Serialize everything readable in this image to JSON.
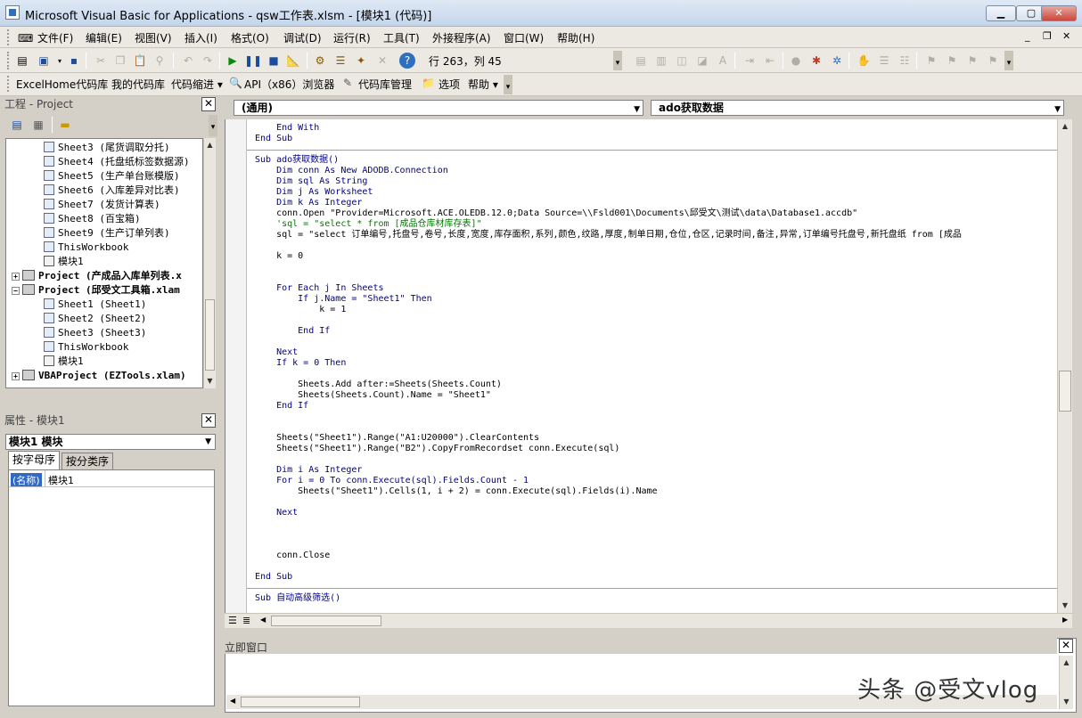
{
  "window": {
    "title": "Microsoft Visual Basic for Applications - qsw工作表.xlsm - [模块1 (代码)]",
    "min": "▁",
    "max": "▢",
    "close": "✕"
  },
  "menu": {
    "items": [
      "文件(F)",
      "编辑(E)",
      "视图(V)",
      "插入(I)",
      "格式(O)",
      "调试(D)",
      "运行(R)",
      "工具(T)",
      "外接程序(A)",
      "窗口(W)",
      "帮助(H)"
    ],
    "mdi_min": "_",
    "mdi_restore": "❐",
    "mdi_close": "✕"
  },
  "toolbar": {
    "position": "行 263，列 45"
  },
  "toolbar2": {
    "items": [
      "ExcelHome代码库",
      "我的代码库",
      "代码缩进 ▾",
      "API（x86）浏览器",
      "代码库管理",
      "选项",
      "帮助 ▾"
    ]
  },
  "project_panel": {
    "title": "工程 - Project",
    "close": "✕"
  },
  "tree": [
    {
      "label": "Sheet3 (尾货调取分托)",
      "type": "sheet"
    },
    {
      "label": "Sheet4 (托盘纸标签数据源)",
      "type": "sheet"
    },
    {
      "label": "Sheet5 (生产单台账模版)",
      "type": "sheet"
    },
    {
      "label": "Sheet6 (入库差异对比表)",
      "type": "sheet"
    },
    {
      "label": "Sheet7 (发货计算表)",
      "type": "sheet"
    },
    {
      "label": "Sheet8 (百宝箱)",
      "type": "sheet"
    },
    {
      "label": "Sheet9 (生产订单列表)",
      "type": "sheet"
    },
    {
      "label": "ThisWorkbook",
      "type": "sheet"
    },
    {
      "label": "模块1",
      "type": "module"
    },
    {
      "label": "Project (产成品入库单列表.x",
      "type": "project",
      "toggle": "+"
    },
    {
      "label": "Project (邱受文工具箱.xlam",
      "type": "project",
      "toggle": "−"
    },
    {
      "label": "Sheet1 (Sheet1)",
      "type": "sheet"
    },
    {
      "label": "Sheet2 (Sheet2)",
      "type": "sheet"
    },
    {
      "label": "Sheet3 (Sheet3)",
      "type": "sheet"
    },
    {
      "label": "ThisWorkbook",
      "type": "sheet"
    },
    {
      "label": "模块1",
      "type": "module"
    },
    {
      "label": "VBAProject (EZTools.xlam)",
      "type": "project",
      "toggle": "+"
    }
  ],
  "props_panel": {
    "title": "属性 - 模块1",
    "close": "✕",
    "object": "模块1 模块",
    "tab_alpha": "按字母序",
    "tab_cat": "按分类序",
    "prop_key": "(名称)",
    "prop_val": "模块1"
  },
  "code_panel": {
    "object_combo": "(通用)",
    "proc_combo": "ado获取数据"
  },
  "code_lines": [
    {
      "text": "    End With",
      "kind": "kw"
    },
    {
      "text": "End Sub",
      "kind": "kw"
    },
    {
      "text": "",
      "kind": "sep"
    },
    {
      "text": "Sub ado获取数据()",
      "kind": "kw"
    },
    {
      "text": "    Dim conn As New ADODB.Connection",
      "kind": "kw"
    },
    {
      "text": "    Dim sql As String",
      "kind": "kw"
    },
    {
      "text": "    Dim j As Worksheet",
      "kind": "kw"
    },
    {
      "text": "    Dim k As Integer",
      "kind": "kw"
    },
    {
      "text": "    conn.Open \"Provider=Microsoft.ACE.OLEDB.12.0;Data Source=\\\\Fsld001\\Documents\\邱受文\\测试\\data\\Database1.accdb\"",
      "kind": "code"
    },
    {
      "text": "    'sql = \"select * from [成品仓库材库存表]\"",
      "kind": "cm"
    },
    {
      "text": "    sql = \"select 订单编号,托盘号,卷号,长度,宽度,库存面积,系列,颜色,纹路,厚度,制单日期,仓位,仓区,记录时间,备注,异常,订单编号托盘号,新托盘纸 from [成品",
      "kind": "code"
    },
    {
      "text": "",
      "kind": "code"
    },
    {
      "text": "    k = 0",
      "kind": "code"
    },
    {
      "text": "",
      "kind": "code"
    },
    {
      "text": "",
      "kind": "code"
    },
    {
      "text": "    For Each j In Sheets",
      "kind": "kw"
    },
    {
      "text": "        If j.Name = \"Sheet1\" Then",
      "kind": "kw"
    },
    {
      "text": "            k = 1",
      "kind": "code"
    },
    {
      "text": "",
      "kind": "code"
    },
    {
      "text": "        End If",
      "kind": "kw"
    },
    {
      "text": "",
      "kind": "code"
    },
    {
      "text": "    Next",
      "kind": "kw"
    },
    {
      "text": "    If k = 0 Then",
      "kind": "kw"
    },
    {
      "text": "",
      "kind": "code"
    },
    {
      "text": "        Sheets.Add after:=Sheets(Sheets.Count)",
      "kind": "code"
    },
    {
      "text": "        Sheets(Sheets.Count).Name = \"Sheet1\"",
      "kind": "code"
    },
    {
      "text": "    End If",
      "kind": "kw"
    },
    {
      "text": "",
      "kind": "code"
    },
    {
      "text": "",
      "kind": "code"
    },
    {
      "text": "    Sheets(\"Sheet1\").Range(\"A1:U20000\").ClearContents",
      "kind": "code"
    },
    {
      "text": "    Sheets(\"Sheet1\").Range(\"B2\").CopyFromRecordset conn.Execute(sql)",
      "kind": "code"
    },
    {
      "text": "",
      "kind": "code"
    },
    {
      "text": "    Dim i As Integer",
      "kind": "kw"
    },
    {
      "text": "    For i = 0 To conn.Execute(sql).Fields.Count - 1",
      "kind": "kw"
    },
    {
      "text": "        Sheets(\"Sheet1\").Cells(1, i + 2) = conn.Execute(sql).Fields(i).Name",
      "kind": "code"
    },
    {
      "text": "",
      "kind": "code"
    },
    {
      "text": "    Next",
      "kind": "kw"
    },
    {
      "text": "",
      "kind": "code"
    },
    {
      "text": "",
      "kind": "code"
    },
    {
      "text": "",
      "kind": "code"
    },
    {
      "text": "    conn.Close",
      "kind": "code"
    },
    {
      "text": "",
      "kind": "code"
    },
    {
      "text": "End Sub",
      "kind": "kw"
    },
    {
      "text": "",
      "kind": "sep"
    },
    {
      "text": "Sub 自动高级筛选()",
      "kind": "kw"
    }
  ],
  "immediate": {
    "title": "立即窗口",
    "close": "✕"
  },
  "watermark": "头条 @受文vlog"
}
